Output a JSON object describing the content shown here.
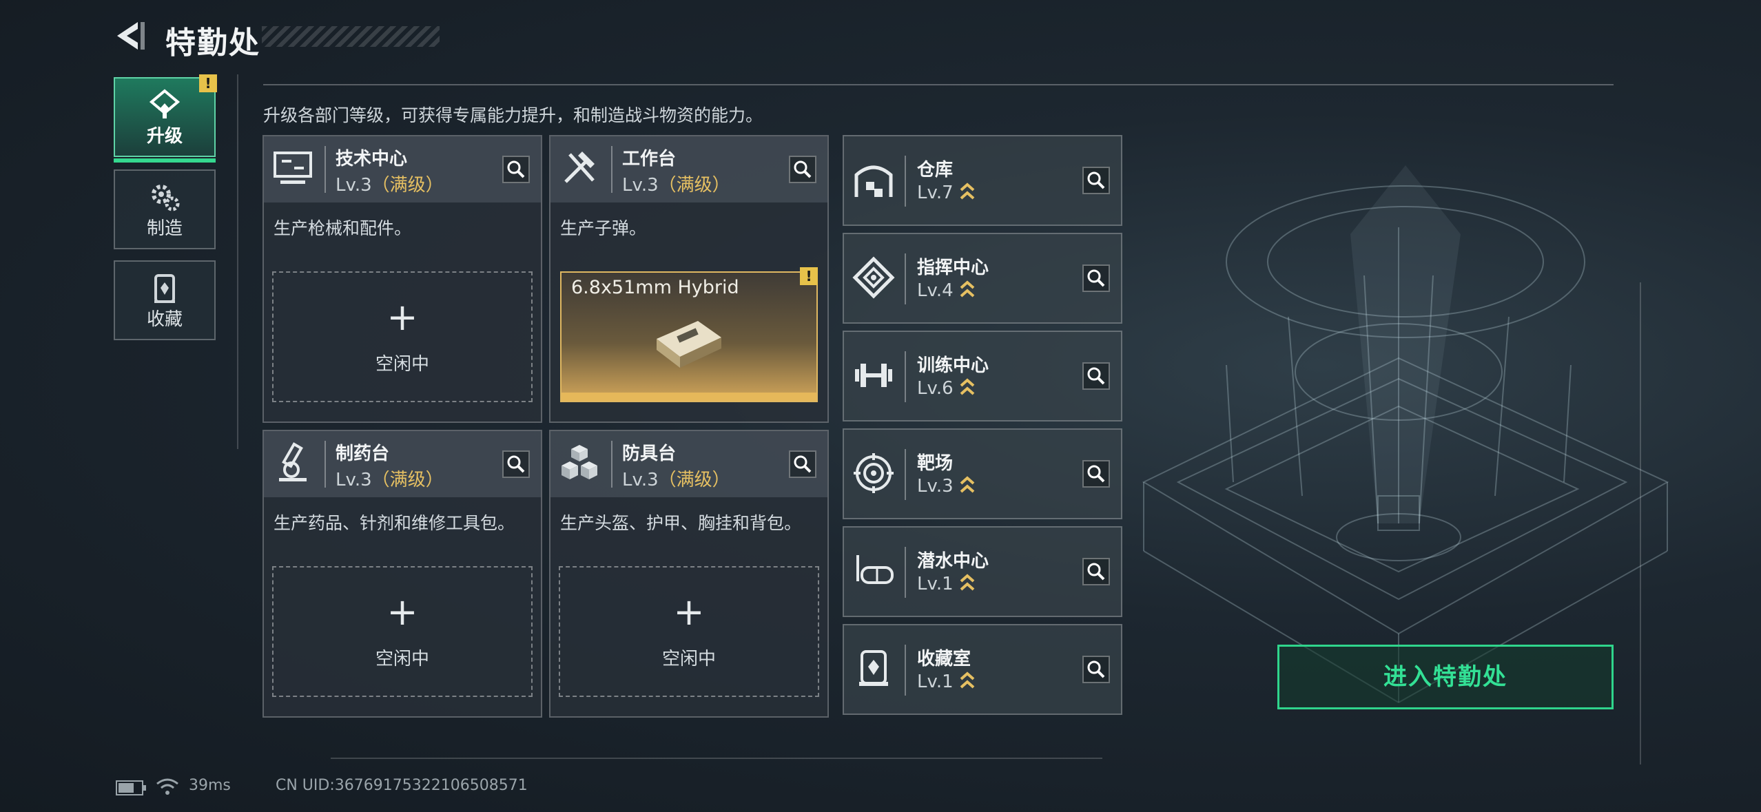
{
  "header": {
    "title": "特勤处"
  },
  "description": "升级各部门等级，可获得专属能力提升，和制造战斗物资的能力。",
  "nav": [
    {
      "label": "升级",
      "icon": "upgrade-icon",
      "active": true,
      "badge": "!"
    },
    {
      "label": "制造",
      "icon": "gears-icon",
      "active": false
    },
    {
      "label": "收藏",
      "icon": "collection-icon",
      "active": false
    }
  ],
  "cards": [
    {
      "name": "技术中心",
      "level": "Lv.3",
      "max": "（满级）",
      "desc": "生产枪械和配件。",
      "slot": {
        "plus": "+",
        "text": "空闲中"
      },
      "icon": "monitor-icon"
    },
    {
      "name": "工作台",
      "level": "Lv.3",
      "max": "（满级）",
      "desc": "生产子弹。",
      "product": {
        "name": "6.8x51mm Hybrid",
        "badge": "!"
      },
      "icon": "tools-icon"
    },
    {
      "name": "制药台",
      "level": "Lv.3",
      "max": "（满级）",
      "desc": "生产药品、针剂和维修工具包。",
      "slot": {
        "plus": "+",
        "text": "空闲中"
      },
      "icon": "microscope-icon"
    },
    {
      "name": "防具台",
      "level": "Lv.3",
      "max": "（满级）",
      "desc": "生产头盔、护甲、胸挂和背包。",
      "slot": {
        "plus": "+",
        "text": "空闲中"
      },
      "icon": "armor-boxes-icon"
    }
  ],
  "facilities": [
    {
      "name": "仓库",
      "level": "Lv.7",
      "icon": "warehouse-icon"
    },
    {
      "name": "指挥中心",
      "level": "Lv.4",
      "icon": "command-icon"
    },
    {
      "name": "训练中心",
      "level": "Lv.6",
      "icon": "dumbbell-icon"
    },
    {
      "name": "靶场",
      "level": "Lv.3",
      "icon": "target-icon"
    },
    {
      "name": "潜水中心",
      "level": "Lv.1",
      "icon": "diving-mask-icon"
    },
    {
      "name": "收藏室",
      "level": "Lv.1",
      "icon": "vault-icon"
    }
  ],
  "enter_button": "进入特勤处",
  "status": {
    "ping": "39ms",
    "uid": "CN UID:3676917532210650857​1"
  },
  "colors": {
    "accent_green": "#2fd58c",
    "max_gold": "#e6c062",
    "badge_yellow": "#e7c24a"
  }
}
